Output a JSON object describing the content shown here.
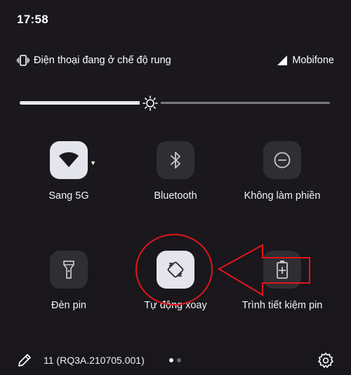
{
  "status_bar": {
    "time": "17:58"
  },
  "header": {
    "vibrate_icon": "vibrate-icon",
    "ringer_mode": "Điện thoại đang ở chế độ rung",
    "signal_icon": "signal-icon",
    "carrier": "Mobifone"
  },
  "brightness": {
    "level": 0.42,
    "icon": "sun-icon"
  },
  "tiles": [
    {
      "label": "Sang 5G",
      "icon": "wifi-icon",
      "active": true
    },
    {
      "label": "Bluetooth",
      "icon": "bluetooth-icon",
      "active": false
    },
    {
      "label": "Không làm phiền",
      "icon": "do-not-disturb-icon",
      "active": false
    },
    {
      "label": "Đèn pin",
      "icon": "flashlight-icon",
      "active": false
    },
    {
      "label": "Tự động xoay",
      "icon": "auto-rotate-icon",
      "active": true
    },
    {
      "label": "Trình tiết kiệm pin",
      "icon": "battery-saver-icon",
      "active": false
    }
  ],
  "footer": {
    "edit_icon": "pencil-icon",
    "build_number": "11 (RQ3A.210705.001)",
    "pages": 2,
    "current_page": 1,
    "settings_icon": "gear-icon"
  },
  "annotations": {
    "color": "#e0161b"
  }
}
